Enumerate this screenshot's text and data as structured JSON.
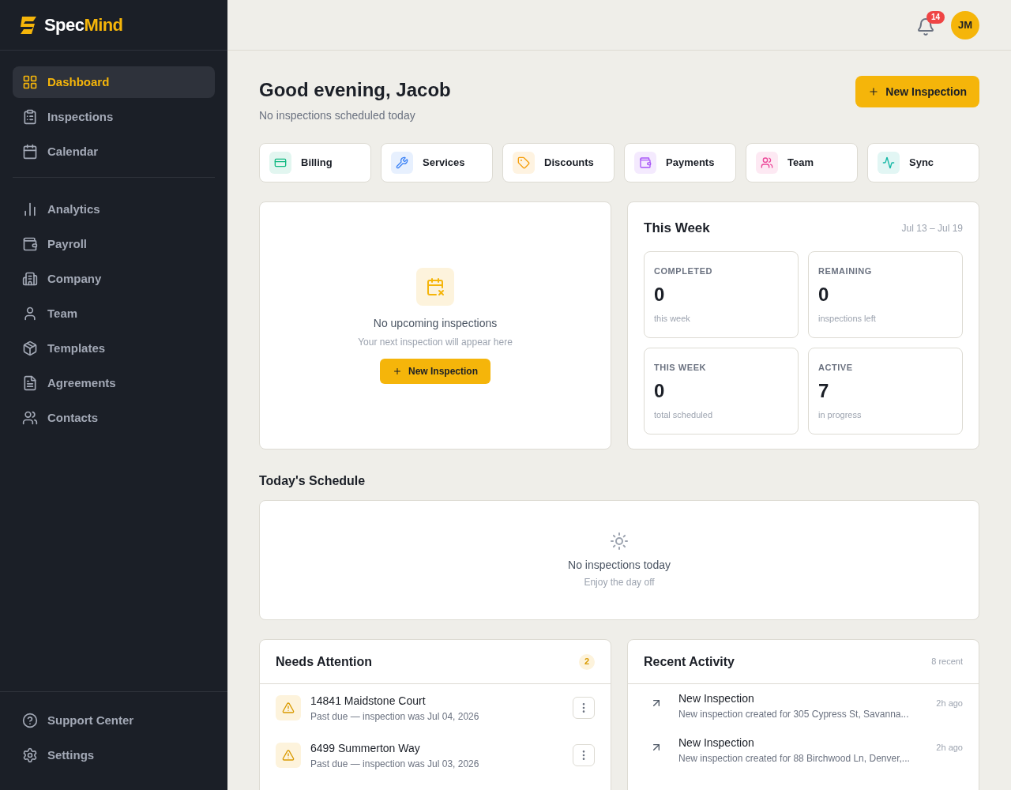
{
  "brand": {
    "first": "Spec",
    "second": "Mind"
  },
  "sidebar": {
    "groups": [
      [
        {
          "label": "Dashboard",
          "selected": true
        },
        {
          "label": "Inspections",
          "selected": false
        },
        {
          "label": "Calendar",
          "selected": false
        }
      ],
      [
        {
          "label": "Analytics",
          "selected": false
        },
        {
          "label": "Payroll",
          "selected": false
        },
        {
          "label": "Company",
          "selected": false
        },
        {
          "label": "Team",
          "selected": false
        },
        {
          "label": "Templates",
          "selected": false
        },
        {
          "label": "Agreements",
          "selected": false
        },
        {
          "label": "Contacts",
          "selected": false
        }
      ]
    ],
    "footer": [
      {
        "label": "Support Center"
      },
      {
        "label": "Settings"
      }
    ]
  },
  "header": {
    "notifications": "14",
    "avatar": "JM"
  },
  "greeting": {
    "title": "Good evening, Jacob",
    "subtitle": "No inspections scheduled today",
    "button": "New Inspection"
  },
  "quick_actions": [
    {
      "label": "Billing",
      "color": "#10b981"
    },
    {
      "label": "Services",
      "color": "#3b82f6"
    },
    {
      "label": "Discounts",
      "color": "#f59e0b"
    },
    {
      "label": "Payments",
      "color": "#a855f7"
    },
    {
      "label": "Team",
      "color": "#ec4899"
    },
    {
      "label": "Sync",
      "color": "#14b8a6"
    }
  ],
  "upcoming": {
    "title": "No upcoming inspections",
    "subtitle": "Your next inspection will appear here",
    "button": "New Inspection"
  },
  "this_week": {
    "title": "This Week",
    "range": "Jul 13 – Jul 19",
    "stats": [
      {
        "label": "COMPLETED",
        "value": "0",
        "note": "this week"
      },
      {
        "label": "REMAINING",
        "value": "0",
        "note": "inspections left"
      },
      {
        "label": "THIS WEEK",
        "value": "0",
        "note": "total scheduled"
      },
      {
        "label": "ACTIVE",
        "value": "7",
        "note": "in progress"
      }
    ]
  },
  "schedule": {
    "title": "Today's Schedule",
    "empty_title": "No inspections today",
    "empty_subtitle": "Enjoy the day off"
  },
  "needs_attention": {
    "title": "Needs Attention",
    "count": "2",
    "items": [
      {
        "address": "14841 Maidstone Court",
        "detail": "Past due — inspection was Jul 04, 2026"
      },
      {
        "address": "6499 Summerton Way",
        "detail": "Past due — inspection was Jul 03, 2026"
      }
    ]
  },
  "recent_activity": {
    "title": "Recent Activity",
    "count": "8 recent",
    "items": [
      {
        "title": "New Inspection",
        "detail": "New inspection created for 305 Cypress St, Savanna...",
        "time": "2h ago"
      },
      {
        "title": "New Inspection",
        "detail": "New inspection created for 88 Birchwood Ln, Denver,...",
        "time": "2h ago"
      }
    ]
  }
}
